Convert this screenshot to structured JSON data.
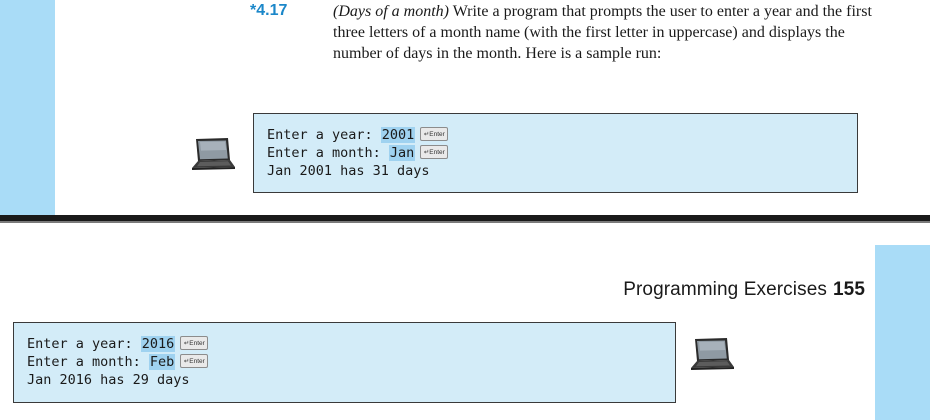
{
  "exercise": {
    "number": "*4.17",
    "title": "(Days of a month)",
    "body": " Write a program that prompts the user to enter a year and the first three letters of a month name (with the first letter in uppercase) and displays the number of days in the month. Here is a sample run:"
  },
  "enter_key_label": "↵Enter",
  "sample_run_1": {
    "prompt_year": "Enter a year: ",
    "input_year": "2001",
    "prompt_month": "Enter a month: ",
    "input_month": "Jan",
    "output": "Jan 2001 has 31 days"
  },
  "running_head": {
    "section": "Programming Exercises",
    "page_number": "155"
  },
  "sample_run_2": {
    "prompt_year": "Enter a year: ",
    "input_year": "2016",
    "prompt_month": "Enter a month: ",
    "input_month": "Feb",
    "output": "Jan 2016 has 29 days"
  },
  "colors": {
    "accent": "#1b87c9",
    "side_band": "#a9dcf7",
    "run_box_bg": "#d3ecf8",
    "input_highlight": "#9fd2f0"
  },
  "icons": [
    "laptop-icon"
  ]
}
